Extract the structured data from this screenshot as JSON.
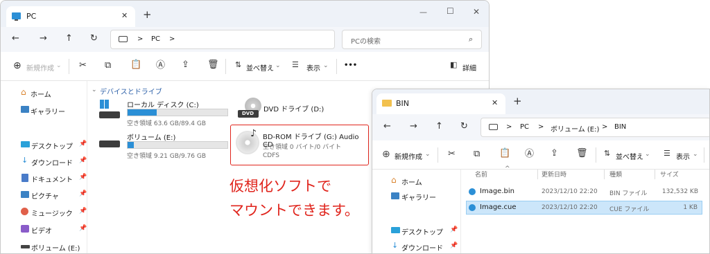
{
  "win1": {
    "tab_title": "PC",
    "new_tab": "+",
    "controls": {
      "minimize": "—",
      "maximize": "☐",
      "close": "✕"
    },
    "nav": {
      "back": "←",
      "forward": "→",
      "up": "↑",
      "refresh": "↻"
    },
    "breadcrumb": {
      "sep1": ">",
      "item": "PC",
      "sep2": ">"
    },
    "search_placeholder": "PCの検索",
    "toolbar": {
      "new": "新規作成",
      "sort": "並べ替え",
      "view": "表示",
      "more": "•••",
      "details": "詳細"
    },
    "sidebar": {
      "home": "ホーム",
      "gallery": "ギャラリー",
      "desktop": "デスクトップ",
      "downloads": "ダウンロード",
      "documents": "ドキュメント",
      "pictures": "ピクチャ",
      "music": "ミュージック",
      "videos": "ビデオ",
      "volume": "ボリューム (E:)"
    },
    "section_title": "デバイスとドライブ",
    "drives": {
      "c": {
        "name": "ローカル ディスク (C:)",
        "space": "空き領域 63.6 GB/89.4 GB",
        "used_fraction": 0.29
      },
      "d": {
        "name": "DVD ドライブ (D:)",
        "badge": "DVD"
      },
      "e": {
        "name": "ボリューム (E:)",
        "space": "空き領域 9.21 GB/9.76 GB",
        "used_fraction": 0.06
      },
      "g": {
        "name": "BD-ROM ドライブ (G:) Audio CD",
        "space": "空き領域 0 バイト/0 バイト",
        "fs": "CDFS"
      }
    },
    "annotation": {
      "line1": "仮想化ソフトで",
      "line2": "マウントできます。"
    }
  },
  "win2": {
    "tab_title": "BIN",
    "new_tab": "+",
    "close": "✕",
    "nav": {
      "back": "←",
      "forward": "→",
      "up": "↑",
      "refresh": "↻"
    },
    "breadcrumb": {
      "sep1": ">",
      "pc": "PC",
      "sep2": ">",
      "volume": "ボリューム (E:)",
      "sep3": ">",
      "bin": "BIN"
    },
    "toolbar": {
      "new": "新規作成",
      "sort": "並べ替え",
      "view": "表示"
    },
    "sidebar": {
      "home": "ホーム",
      "gallery": "ギャラリー",
      "desktop": "デスクトップ",
      "downloads": "ダウンロード"
    },
    "columns": {
      "name": "名前",
      "date": "更新日時",
      "type": "種類",
      "size": "サイズ"
    },
    "files": [
      {
        "name": "Image.bin",
        "date": "2023/12/10 22:20",
        "type": "BIN ファイル",
        "size": "132,532 KB"
      },
      {
        "name": "Image.cue",
        "date": "2023/12/10 22:20",
        "type": "CUE ファイル",
        "size": "1 KB"
      }
    ]
  },
  "colors": {
    "accent": "#2b8fd6",
    "annotation_red": "#e0241c",
    "selected_row": "#cce6fa"
  }
}
